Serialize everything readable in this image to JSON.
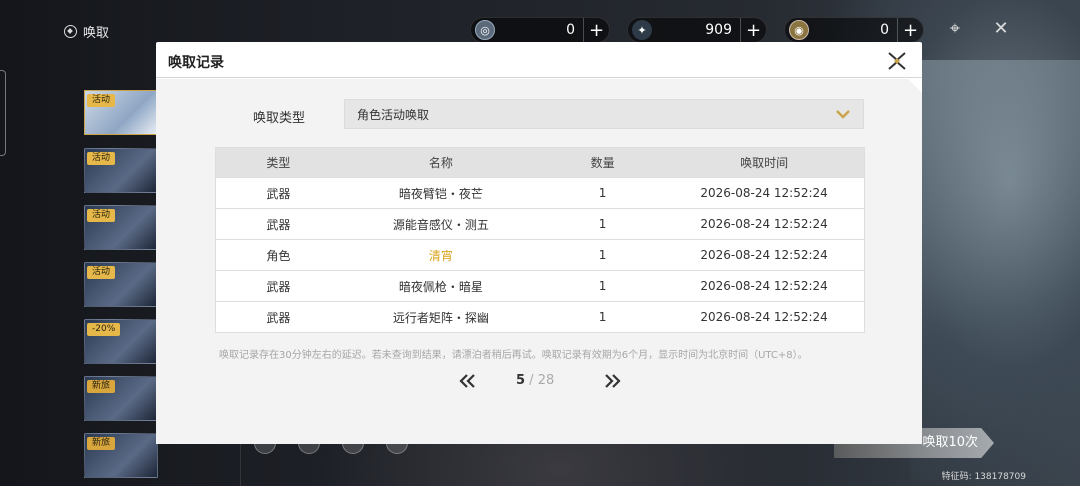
{
  "app": {
    "title": "唤取"
  },
  "currencies": [
    {
      "value": "0",
      "icon": "coin-a-icon",
      "plus": "+"
    },
    {
      "value": "909",
      "icon": "star-icon",
      "plus": "+"
    },
    {
      "value": "0",
      "icon": "coin-b-icon",
      "plus": "+"
    }
  ],
  "sidebar": {
    "banners": [
      {
        "tag": "活动"
      },
      {
        "tag": "活动"
      },
      {
        "tag": "活动"
      },
      {
        "tag": "活动"
      },
      {
        "tag": "-20%"
      },
      {
        "tag": "新旅"
      },
      {
        "tag": "新旅"
      }
    ]
  },
  "background": {
    "pull_button": "唤取10次",
    "uid": "特征码: 138178709"
  },
  "dialog": {
    "title": "唤取记录",
    "type_label": "唤取类型",
    "type_value": "角色活动唤取",
    "table": {
      "headers": [
        "类型",
        "名称",
        "数量",
        "唤取时间"
      ],
      "rows": [
        {
          "type": "武器",
          "name": "暗夜臂铠・夜芒",
          "qty": "1",
          "time": "2026-08-24 12:52:24",
          "highlight": false
        },
        {
          "type": "武器",
          "name": "源能音感仪・测五",
          "qty": "1",
          "time": "2026-08-24 12:52:24",
          "highlight": false
        },
        {
          "type": "角色",
          "name": "清宵",
          "qty": "1",
          "time": "2026-08-24 12:52:24",
          "highlight": true
        },
        {
          "type": "武器",
          "name": "暗夜佩枪・暗星",
          "qty": "1",
          "time": "2026-08-24 12:52:24",
          "highlight": false
        },
        {
          "type": "武器",
          "name": "远行者矩阵・探幽",
          "qty": "1",
          "time": "2026-08-24 12:52:24",
          "highlight": false
        }
      ]
    },
    "note": "唤取记录存在30分钟左右的延迟。若未查询到结果，请漂泊者稍后再试。唤取记录有效期为6个月，显示时间为北京时间（UTC+8）。",
    "pagination": {
      "current": "5",
      "separator": " / ",
      "total": "28"
    }
  },
  "colors": {
    "highlight": "#d8a21c",
    "accent": "#c9a44a"
  }
}
